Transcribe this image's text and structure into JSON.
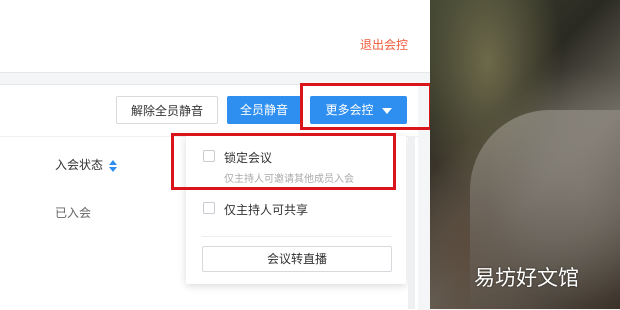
{
  "header": {
    "exit_label": "退出会控"
  },
  "toolbar": {
    "unmute_all_label": "解除全员静音",
    "mute_all_label": "全员静音",
    "more_label": "更多会控"
  },
  "table": {
    "column_status_header": "入会状态",
    "row_status": "已入会"
  },
  "dropdown": {
    "lock_label": "锁定会议",
    "lock_desc": "仅主持人可邀请其他成员入会",
    "host_share_label": "仅主持人可共享",
    "live_button_label": "会议转直播"
  },
  "photo": {
    "watermark": "易坊好文馆"
  },
  "colors": {
    "primary": "#2e8ff0",
    "exit": "#ef5b3a",
    "highlight": "#d9141a"
  }
}
